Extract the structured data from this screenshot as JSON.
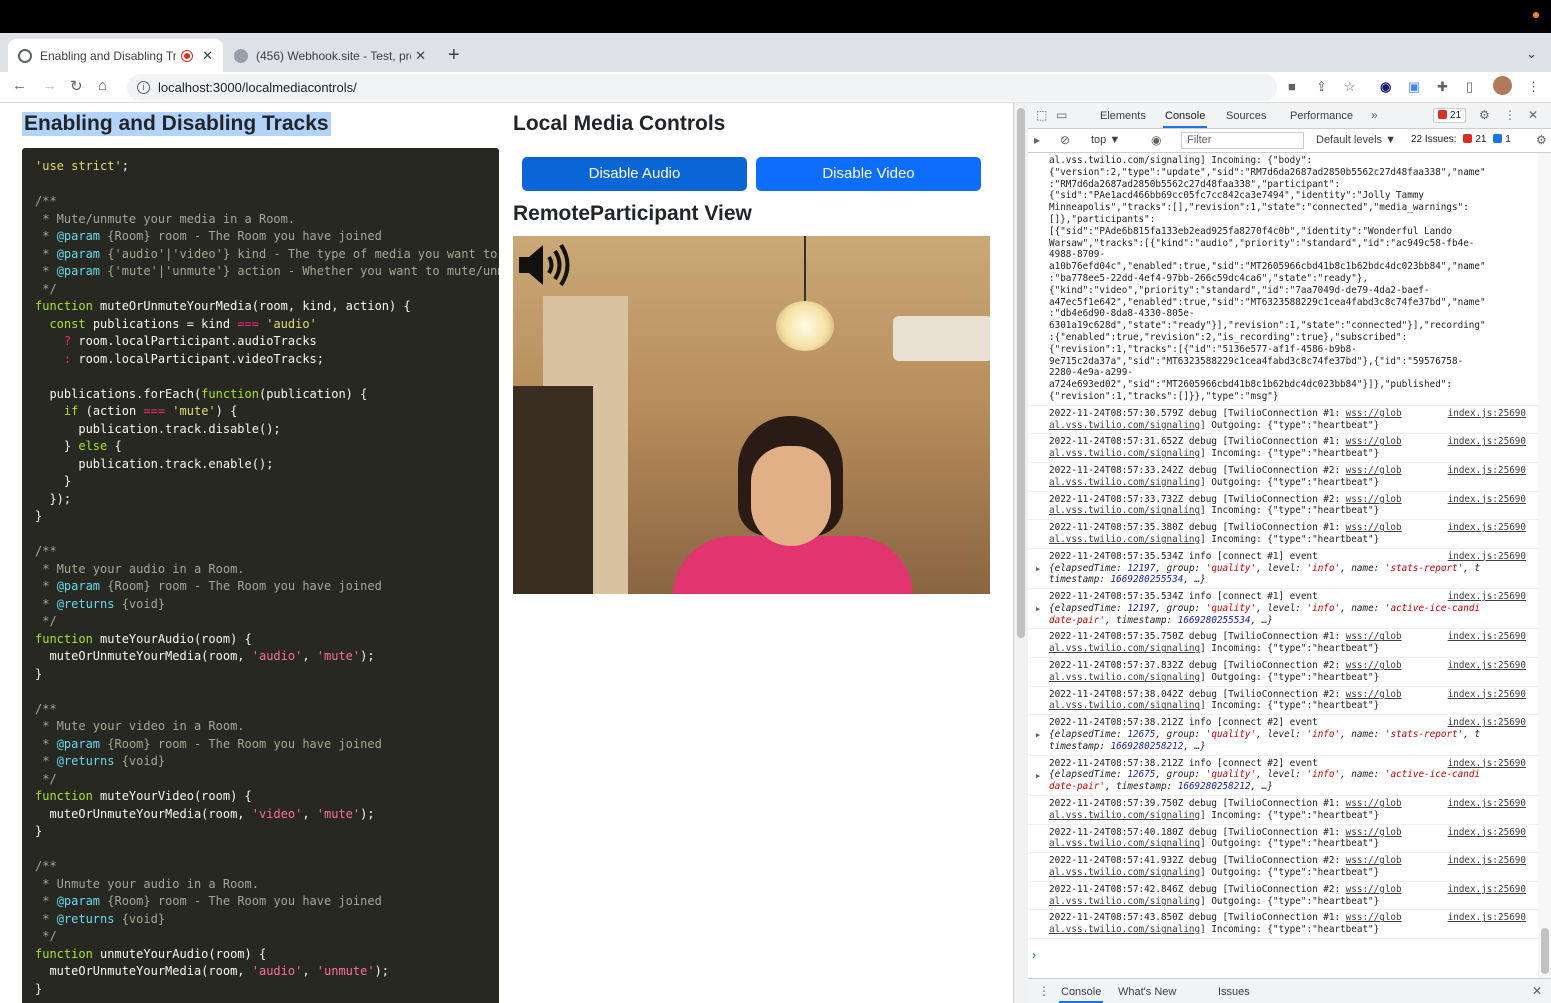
{
  "browser": {
    "tabs": [
      {
        "title": "Enabling and Disabling Tra",
        "active": true
      },
      {
        "title": "(456) Webhook.site - Test, pro",
        "active": false
      }
    ],
    "url": "localhost:3000/localmediacontrols/"
  },
  "page": {
    "heading": "Enabling and Disabling Tracks",
    "code_lines": [
      [
        [
          "c-str",
          "'use strict'"
        ],
        [
          "c-prop",
          ";"
        ]
      ],
      [],
      [
        [
          "c-com",
          "/**"
        ]
      ],
      [
        [
          "c-com",
          " * Mute/unmute your media in a Room."
        ]
      ],
      [
        [
          "c-com",
          " * "
        ],
        [
          "c-tag",
          "@param"
        ],
        [
          "c-com",
          " {Room} room - The Room you have joined"
        ]
      ],
      [
        [
          "c-com",
          " * "
        ],
        [
          "c-tag",
          "@param"
        ],
        [
          "c-com",
          " {'audio'|'video'} kind - The type of media you want to mu"
        ]
      ],
      [
        [
          "c-com",
          " * "
        ],
        [
          "c-tag",
          "@param"
        ],
        [
          "c-com",
          " {'mute'|'unmute'} action - Whether you want to mute/unmut"
        ]
      ],
      [
        [
          "c-com",
          " */"
        ]
      ],
      [
        [
          "c-fn",
          "function "
        ],
        [
          "c-prop",
          "muteOrUnmuteYourMedia(room, kind, action) {"
        ]
      ],
      [
        [
          "c-prop",
          "  "
        ],
        [
          "c-fn",
          "const "
        ],
        [
          "c-prop",
          "publications = kind "
        ],
        [
          "c-kw",
          "==="
        ],
        [
          "c-str",
          " 'audio'"
        ]
      ],
      [
        [
          "c-prop",
          "    "
        ],
        [
          "c-kw",
          "? "
        ],
        [
          "c-prop",
          "room.localParticipant.audioTracks"
        ]
      ],
      [
        [
          "c-prop",
          "    "
        ],
        [
          "c-kw",
          ": "
        ],
        [
          "c-prop",
          "room.localParticipant.videoTracks;"
        ]
      ],
      [],
      [
        [
          "c-prop",
          "  publications.forEach("
        ],
        [
          "c-fn",
          "function"
        ],
        [
          "c-prop",
          "(publication) {"
        ]
      ],
      [
        [
          "c-prop",
          "    "
        ],
        [
          "c-fn",
          "if "
        ],
        [
          "c-prop",
          "(action "
        ],
        [
          "c-kw",
          "==="
        ],
        [
          "c-str",
          " 'mute'"
        ],
        [
          "c-prop",
          ") {"
        ]
      ],
      [
        [
          "c-prop",
          "      publication.track.disable();"
        ]
      ],
      [
        [
          "c-prop",
          "    } "
        ],
        [
          "c-fn",
          "else "
        ],
        [
          "c-prop",
          "{"
        ]
      ],
      [
        [
          "c-prop",
          "      publication.track.enable();"
        ]
      ],
      [
        [
          "c-prop",
          "    }"
        ]
      ],
      [
        [
          "c-prop",
          "  });"
        ]
      ],
      [
        [
          "c-prop",
          "}"
        ]
      ],
      [],
      [
        [
          "c-com",
          "/**"
        ]
      ],
      [
        [
          "c-com",
          " * Mute your audio in a Room."
        ]
      ],
      [
        [
          "c-com",
          " * "
        ],
        [
          "c-tag",
          "@param"
        ],
        [
          "c-com",
          " {Room} room - The Room you have joined"
        ]
      ],
      [
        [
          "c-com",
          " * "
        ],
        [
          "c-tag",
          "@returns"
        ],
        [
          "c-com",
          " {void}"
        ]
      ],
      [
        [
          "c-com",
          " */"
        ]
      ],
      [
        [
          "c-fn",
          "function "
        ],
        [
          "c-prop",
          "muteYourAudio(room) {"
        ]
      ],
      [
        [
          "c-prop",
          "  muteOrUnmuteYourMedia(room, "
        ],
        [
          "c-str2",
          "'audio'"
        ],
        [
          "c-prop",
          ", "
        ],
        [
          "c-str2",
          "'mute'"
        ],
        [
          "c-prop",
          ");"
        ]
      ],
      [
        [
          "c-prop",
          "}"
        ]
      ],
      [],
      [
        [
          "c-com",
          "/**"
        ]
      ],
      [
        [
          "c-com",
          " * Mute your video in a Room."
        ]
      ],
      [
        [
          "c-com",
          " * "
        ],
        [
          "c-tag",
          "@param"
        ],
        [
          "c-com",
          " {Room} room - The Room you have joined"
        ]
      ],
      [
        [
          "c-com",
          " * "
        ],
        [
          "c-tag",
          "@returns"
        ],
        [
          "c-com",
          " {void}"
        ]
      ],
      [
        [
          "c-com",
          " */"
        ]
      ],
      [
        [
          "c-fn",
          "function "
        ],
        [
          "c-prop",
          "muteYourVideo(room) {"
        ]
      ],
      [
        [
          "c-prop",
          "  muteOrUnmuteYourMedia(room, "
        ],
        [
          "c-str2",
          "'video'"
        ],
        [
          "c-prop",
          ", "
        ],
        [
          "c-str2",
          "'mute'"
        ],
        [
          "c-prop",
          ");"
        ]
      ],
      [
        [
          "c-prop",
          "}"
        ]
      ],
      [],
      [
        [
          "c-com",
          "/**"
        ]
      ],
      [
        [
          "c-com",
          " * Unmute your audio in a Room."
        ]
      ],
      [
        [
          "c-com",
          " * "
        ],
        [
          "c-tag",
          "@param"
        ],
        [
          "c-com",
          " {Room} room - The Room you have joined"
        ]
      ],
      [
        [
          "c-com",
          " * "
        ],
        [
          "c-tag",
          "@returns"
        ],
        [
          "c-com",
          " {void}"
        ]
      ],
      [
        [
          "c-com",
          " */"
        ]
      ],
      [
        [
          "c-fn",
          "function "
        ],
        [
          "c-prop",
          "unmuteYourAudio(room) {"
        ]
      ],
      [
        [
          "c-prop",
          "  muteOrUnmuteYourMedia(room, "
        ],
        [
          "c-str2",
          "'audio'"
        ],
        [
          "c-prop",
          ", "
        ],
        [
          "c-str2",
          "'unmute'"
        ],
        [
          "c-prop",
          ");"
        ]
      ],
      [
        [
          "c-prop",
          "}"
        ]
      ]
    ],
    "local_media": {
      "heading": "Local Media Controls",
      "disable_audio": "Disable Audio",
      "disable_video": "Disable Video",
      "button_colors": [
        "#0a66d6",
        "#0d6efd"
      ]
    },
    "remote_heading": "RemoteParticipant View"
  },
  "devtools": {
    "tabs": [
      "Elements",
      "Console",
      "Sources",
      "Performance"
    ],
    "active_tab": "Console",
    "error_count": "21",
    "context": "top ▼",
    "filter_placeholder": "Filter",
    "levels": "Default levels ▼",
    "issues_label": "22 Issues:",
    "issues_errors": "21",
    "issues_info": "1",
    "first_message": [
      "al.vss.twilio.com/signaling] Incoming: {\"body\":",
      "{\"version\":2,\"type\":\"update\",\"sid\":\"RM7d6da2687ad2850b5562c27d48faa338\",\"name\"",
      ":\"RM7d6da2687ad2850b5562c27d48faa338\",\"participant\":",
      "{\"sid\":\"PAe1acd466bb69cc05fc7cc842ca3e7494\",\"identity\":\"Jolly Tammy",
      "Minneapolis\",\"tracks\":[],\"revision\":1,\"state\":\"connected\",\"media_warnings\":",
      "[]},\"participants\":",
      "[{\"sid\":\"PAde6b815fa133eb2ead925fa8270f4c0b\",\"identity\":\"Wonderful Lando",
      "Warsaw\",\"tracks\":[{\"kind\":\"audio\",\"priority\":\"standard\",\"id\":\"ac949c58-fb4e-",
      "4988-8709-",
      "a10b76efd04c\",\"enabled\":true,\"sid\":\"MT2605966cbd41b8c1b62bdc4dc023bb84\",\"name\"",
      ":\"ba778ee5-22dd-4ef4-97bb-266c59dc4ca6\",\"state\":\"ready\"},",
      "{\"kind\":\"video\",\"priority\":\"standard\",\"id\":\"7aa7049d-de79-4da2-baef-",
      "a47ec5f1e642\",\"enabled\":true,\"sid\":\"MT6323588229c1cea4fabd3c8c74fe37bd\",\"name\"",
      ":\"db4e6d90-8da8-4330-805e-",
      "6301a19c628d\",\"state\":\"ready\"}],\"revision\":1,\"state\":\"connected\"}],\"recording\"",
      ":{\"enabled\":true,\"revision\":2,\"is_recording\":true},\"subscribed\":",
      "{\"revision\":1,\"tracks\":[{\"id\":\"5136e577-af1f-4586-b9b8-",
      "9e715c2da37a\",\"sid\":\"MT6323588229c1cea4fabd3c8c74fe37bd\"},{\"id\":\"59576758-",
      "2280-4e9a-a299-",
      "a724e693ed02\",\"sid\":\"MT2605966cbd41b8c1b62bdc4dc023bb84\"}]},\"published\":",
      "{\"revision\":1,\"tracks\":[]}},\"type\":\"msg\"}"
    ],
    "messages": [
      {
        "kind": "debug",
        "head": "2022-11-24T08:57:30.579Z debug [TwilioConnection #1: ",
        "link": "wss://glob",
        "tail": "al.vss.twilio.com/signaling",
        "rest": "] Outgoing: {\"type\":\"heartbeat\"}",
        "src": "index.js:25690"
      },
      {
        "kind": "debug",
        "head": "2022-11-24T08:57:31.652Z debug [TwilioConnection #1: ",
        "link": "wss://glob",
        "tail": "al.vss.twilio.com/signaling",
        "rest": "] Incoming: {\"type\":\"heartbeat\"}",
        "src": "index.js:25690"
      },
      {
        "kind": "debug",
        "head": "2022-11-24T08:57:33.242Z debug [TwilioConnection #2: ",
        "link": "wss://glob",
        "tail": "al.vss.twilio.com/signaling",
        "rest": "] Outgoing: {\"type\":\"heartbeat\"}",
        "src": "index.js:25690"
      },
      {
        "kind": "debug",
        "head": "2022-11-24T08:57:33.732Z debug [TwilioConnection #2: ",
        "link": "wss://glob",
        "tail": "al.vss.twilio.com/signaling",
        "rest": "] Incoming: {\"type\":\"heartbeat\"}",
        "src": "index.js:25690"
      },
      {
        "kind": "debug",
        "head": "2022-11-24T08:57:35.380Z debug [TwilioConnection #1: ",
        "link": "wss://glob",
        "tail": "al.vss.twilio.com/signaling",
        "rest": "] Incoming: {\"type\":\"heartbeat\"}",
        "src": "index.js:25690"
      },
      {
        "kind": "info",
        "head": "2022-11-24T08:57:35.534Z info [connect #1] event",
        "elapsed": "12197",
        "group": "'quality'",
        "level": "'info'",
        "name": "'stats-report'",
        "name_tail": ", t",
        "ts_prefix": "timestamp: ",
        "ts": "1669280255534",
        "src": "index.js:25690"
      },
      {
        "kind": "info",
        "head": "2022-11-24T08:57:35.534Z info [connect #1] event",
        "elapsed": "12197",
        "group": "'quality'",
        "level": "'info'",
        "name": "'active-ice-candi",
        "name_tail": "",
        "ts_prefix": "date-pair', timestamp: ",
        "ts": "1669280255534",
        "src": "index.js:25690"
      },
      {
        "kind": "debug",
        "head": "2022-11-24T08:57:35.750Z debug [TwilioConnection #1: ",
        "link": "wss://glob",
        "tail": "al.vss.twilio.com/signaling",
        "rest": "] Incoming: {\"type\":\"heartbeat\"}",
        "src": "index.js:25690"
      },
      {
        "kind": "debug",
        "head": "2022-11-24T08:57:37.832Z debug [TwilioConnection #2: ",
        "link": "wss://glob",
        "tail": "al.vss.twilio.com/signaling",
        "rest": "] Outgoing: {\"type\":\"heartbeat\"}",
        "src": "index.js:25690"
      },
      {
        "kind": "debug",
        "head": "2022-11-24T08:57:38.042Z debug [TwilioConnection #2: ",
        "link": "wss://glob",
        "tail": "al.vss.twilio.com/signaling",
        "rest": "] Incoming: {\"type\":\"heartbeat\"}",
        "src": "index.js:25690"
      },
      {
        "kind": "info",
        "head": "2022-11-24T08:57:38.212Z info [connect #2] event",
        "elapsed": "12675",
        "group": "'quality'",
        "level": "'info'",
        "name": "'stats-report'",
        "name_tail": ", t",
        "ts_prefix": "timestamp: ",
        "ts": "1669280258212",
        "src": "index.js:25690"
      },
      {
        "kind": "info",
        "head": "2022-11-24T08:57:38.212Z info [connect #2] event",
        "elapsed": "12675",
        "group": "'quality'",
        "level": "'info'",
        "name": "'active-ice-candi",
        "name_tail": "",
        "ts_prefix": "date-pair', timestamp: ",
        "ts": "1669280258212",
        "src": "index.js:25690"
      },
      {
        "kind": "debug",
        "head": "2022-11-24T08:57:39.750Z debug [TwilioConnection #1: ",
        "link": "wss://glob",
        "tail": "al.vss.twilio.com/signaling",
        "rest": "] Incoming: {\"type\":\"heartbeat\"}",
        "src": "index.js:25690"
      },
      {
        "kind": "debug",
        "head": "2022-11-24T08:57:40.180Z debug [TwilioConnection #1: ",
        "link": "wss://glob",
        "tail": "al.vss.twilio.com/signaling",
        "rest": "] Outgoing: {\"type\":\"heartbeat\"}",
        "src": "index.js:25690"
      },
      {
        "kind": "debug",
        "head": "2022-11-24T08:57:41.932Z debug [TwilioConnection #2: ",
        "link": "wss://glob",
        "tail": "al.vss.twilio.com/signaling",
        "rest": "] Outgoing: {\"type\":\"heartbeat\"}",
        "src": "index.js:25690"
      },
      {
        "kind": "debug",
        "head": "2022-11-24T08:57:42.846Z debug [TwilioConnection #2: ",
        "link": "wss://glob",
        "tail": "al.vss.twilio.com/signaling",
        "rest": "] Outgoing: {\"type\":\"heartbeat\"}",
        "src": "index.js:25690"
      },
      {
        "kind": "debug",
        "head": "2022-11-24T08:57:43.850Z debug [TwilioConnection #1: ",
        "link": "wss://glob",
        "tail": "al.vss.twilio.com/signaling",
        "rest": "] Incoming: {\"type\":\"heartbeat\"}",
        "src": "index.js:25690"
      }
    ],
    "prompt": "›",
    "drawer_tabs": [
      "Console",
      "What's New",
      "Issues"
    ]
  }
}
